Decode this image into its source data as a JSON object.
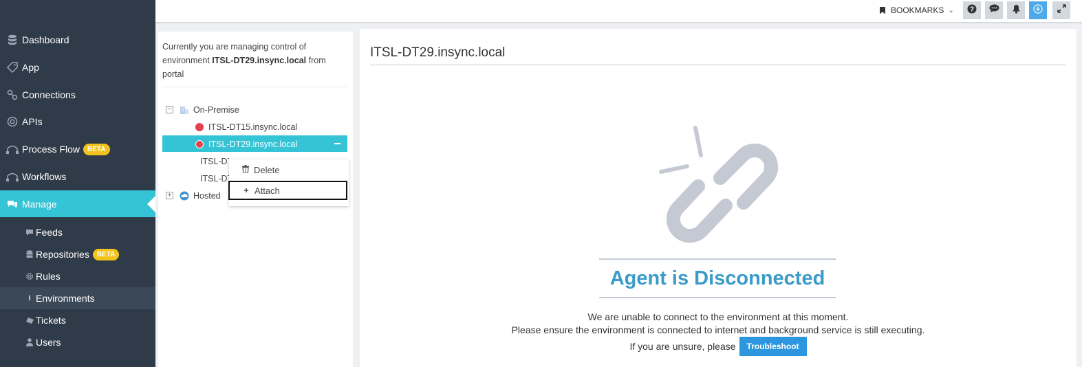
{
  "sidebar": {
    "nav": [
      {
        "label": "Dashboard",
        "icon": "database-icon"
      },
      {
        "label": "App",
        "icon": "tag-icon"
      },
      {
        "label": "Connections",
        "icon": "link-icon"
      },
      {
        "label": "APIs",
        "icon": "lifebuoy-icon"
      },
      {
        "label": "Process Flow",
        "icon": "flow-icon",
        "badge": "BETA"
      },
      {
        "label": "Workflows",
        "icon": "workflow-icon"
      },
      {
        "label": "Manage",
        "icon": "comments-icon",
        "active": true
      }
    ],
    "sub": [
      {
        "label": "Feeds",
        "icon": "comment-icon"
      },
      {
        "label": "Repositories",
        "icon": "database-icon",
        "badge": "BETA"
      },
      {
        "label": "Rules",
        "icon": "gear-icon"
      },
      {
        "label": "Environments",
        "icon": "info-icon",
        "active": true
      },
      {
        "label": "Tickets",
        "icon": "ticket-icon"
      },
      {
        "label": "Users",
        "icon": "user-icon"
      }
    ]
  },
  "topbar": {
    "bookmarks_label": "BOOKMARKS",
    "buttons": [
      "help-icon",
      "chat-icon",
      "bell-icon",
      "download-icon",
      "expand-icon"
    ]
  },
  "left_panel": {
    "intro_prefix": "Currently you are managing control of environment",
    "intro_env": "ITSL-DT29.insync.local",
    "intro_suffix": "from portal",
    "tree": {
      "root_label": "On-Premise",
      "items": [
        {
          "label": "ITSL-DT15.insync.local",
          "status": "disconnected"
        },
        {
          "label": "ITSL-DT29.insync.local",
          "status": "disconnected",
          "selected": true
        },
        {
          "label": "ITSL-DT28.insync.local",
          "status": "disconnected"
        },
        {
          "label": "ITSL-DT30.insync.local",
          "status": "disconnected"
        }
      ],
      "hosted_label": "Hosted"
    },
    "context_menu": {
      "delete_label": "Delete",
      "attach_label": "Attach"
    }
  },
  "main": {
    "env_title": "ITSL-DT29.insync.local",
    "status_title": "Agent is Disconnected",
    "message_line1": "We are unable to connect to the environment at this moment.",
    "message_line2": "Please ensure the environment is connected to internet and background service is still executing.",
    "message_line3": "If you are unsure, please",
    "troubleshoot_label": "Troubleshoot"
  },
  "colors": {
    "sidebar_bg": "#2f3b48",
    "accent": "#35c3d6",
    "status_red": "#e0434d",
    "title_blue": "#3a9bc9",
    "button_blue": "#2c97de",
    "beta_yellow": "#f3c31b"
  }
}
